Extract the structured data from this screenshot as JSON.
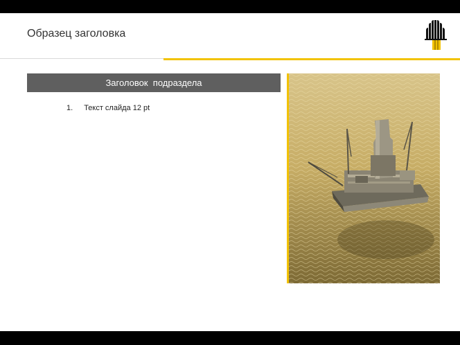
{
  "slide": {
    "title": "Образец заголовка",
    "subheader": "Заголовок  подраздела",
    "list": [
      {
        "number": "1.",
        "text": "Текст слайда 12 pt"
      }
    ]
  },
  "colors": {
    "accent_gold": "#f2c200",
    "subheader_bg": "#5f5f5f",
    "bars": "#000000"
  },
  "icons": {
    "logo": "rosneft-logo",
    "photo": "offshore-oil-platform-photo"
  }
}
